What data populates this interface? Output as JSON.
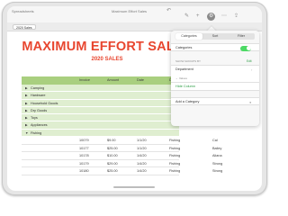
{
  "toolbar": {
    "back_label": "Spreadsheets",
    "doc_title": "Maximum Effort Sales",
    "icons": [
      "undo-icon",
      "brush-icon",
      "add-icon",
      "format-gear-icon",
      "more-icon",
      "share-icon"
    ]
  },
  "sheet_tab": "2020 Sales",
  "sheet": {
    "title": "MAXIMUM EFFORT SALES",
    "subtitle": "2020 SALES",
    "columns": [
      "Invoice",
      "Amount",
      "Date",
      "Dep"
    ],
    "groups": [
      "Camping",
      "Hardware",
      "Household Goods",
      "Dry Goods",
      "Toys",
      "Appliances",
      "Fishing"
    ],
    "rows": [
      {
        "invoice": "10079",
        "amount": "$9.00",
        "date": "1/1/20",
        "dept": "Fishing",
        "name": "Cal"
      },
      {
        "invoice": "10177",
        "amount": "$25.00",
        "date": "1/1/20",
        "dept": "Fishing",
        "name": "Bailey"
      },
      {
        "invoice": "10178",
        "amount": "$10.00",
        "date": "1/4/20",
        "dept": "Fishing",
        "name": "Aliana"
      },
      {
        "invoice": "10179",
        "amount": "$29.00",
        "date": "1/4/20",
        "dept": "Fishing",
        "name": "Strong"
      },
      {
        "invoice": "10180",
        "amount": "$25.00",
        "date": "1/4/20",
        "dept": "Fishing",
        "name": "Strong"
      }
    ]
  },
  "popover": {
    "tabs": [
      "Categories",
      "Sort",
      "Filter"
    ],
    "categories_label": "Categories",
    "categories_on": true,
    "group_section_label": "Show Groups By",
    "edit_label": "Edit",
    "department_label": "Department",
    "values_label": "Values",
    "hide_column_label": "Hide Column",
    "add_category_label": "Add a Category"
  }
}
